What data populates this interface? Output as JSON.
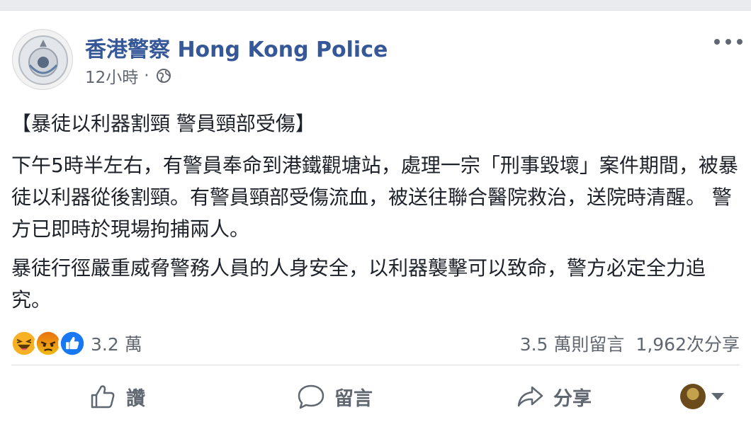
{
  "post": {
    "page_name": "香港警察 Hong Kong Police",
    "time": "12小時",
    "separator": "·",
    "title": "【暴徒以利器割頸 警員頸部受傷】",
    "paragraph1": "下午5時半左右，有警員奉命到港鐵觀塘站，處理一宗「刑事毀壞」案件期間，被暴徒以利器從後割頸。有警員頸部受傷流血，被送往聯合醫院救治，送院時清醒。 警方已即時於現場拘捕兩人。",
    "paragraph2": "暴徒行徑嚴重威脅警務人員的人身安全，以利器襲擊可以致命，警方必定全力追究。"
  },
  "reactions": {
    "icons": [
      "haha-icon",
      "angry-icon",
      "like-icon"
    ],
    "count": "3.2 萬",
    "comments": "3.5 萬則留言",
    "shares": "1,962次分享"
  },
  "actions": {
    "like": "讚",
    "comment": "留言",
    "share": "分享"
  },
  "colors": {
    "page_name": "#365899",
    "text": "#1d2129",
    "muted": "#606770",
    "like_blue": "#1877f2",
    "angry_top": "#e9710f",
    "angry_bottom": "#f0ba15",
    "haha": "#f7b125"
  }
}
